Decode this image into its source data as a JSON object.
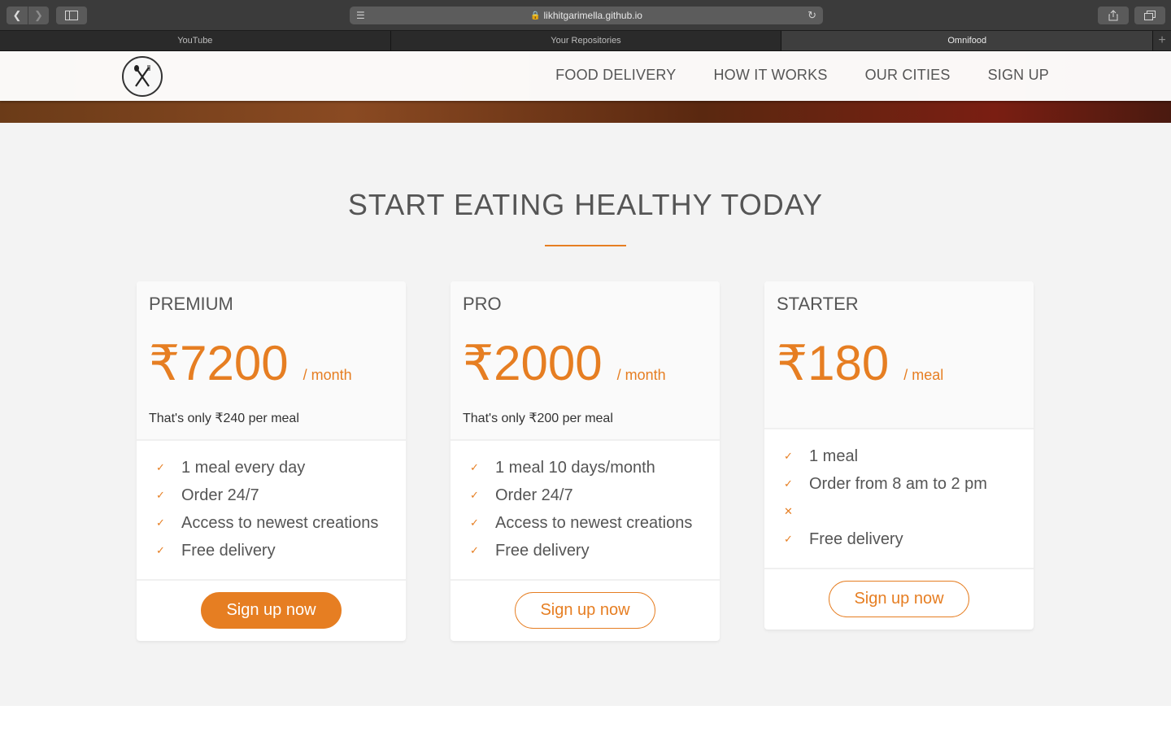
{
  "browser": {
    "url": "likhitgarimella.github.io",
    "tabs": [
      {
        "label": "YouTube",
        "active": false
      },
      {
        "label": "Your Repositories",
        "active": false
      },
      {
        "label": "Omnifood",
        "active": true
      }
    ],
    "icons": [
      "back-icon",
      "forward-icon",
      "sidebar-icon",
      "reader-icon",
      "lock-icon",
      "reload-icon",
      "share-icon",
      "tabs-overview-icon",
      "new-tab-icon"
    ]
  },
  "site": {
    "nav": {
      "food_delivery": "FOOD DELIVERY",
      "how_it_works": "HOW IT WORKS",
      "our_cities": "OUR CITIES",
      "sign_up": "SIGN UP"
    }
  },
  "plans": {
    "title": "START EATING HEALTHY TODAY",
    "accent_color": "#e67e22",
    "cards": [
      {
        "name": "PREMIUM",
        "price": "₹7200",
        "unit": "/ month",
        "per_meal": "That's only ₹240 per meal",
        "features": [
          "1 meal every day",
          "Order 24/7",
          "Access to newest creations",
          "Free delivery"
        ],
        "button": "Sign up now"
      },
      {
        "name": "PRO",
        "price": "₹2000",
        "unit": "/ month",
        "per_meal": "That's only ₹200 per meal",
        "features": [
          "1 meal 10 days/month",
          "Order 24/7",
          "Access to newest creations",
          "Free delivery"
        ],
        "button": "Sign up now"
      },
      {
        "name": "STARTER",
        "price": "₹180",
        "unit": "/ meal",
        "per_meal": "",
        "features": [
          "1 meal",
          "Order from 8 am to 2 pm",
          "",
          "Free delivery"
        ],
        "button": "Sign up now"
      }
    ]
  }
}
